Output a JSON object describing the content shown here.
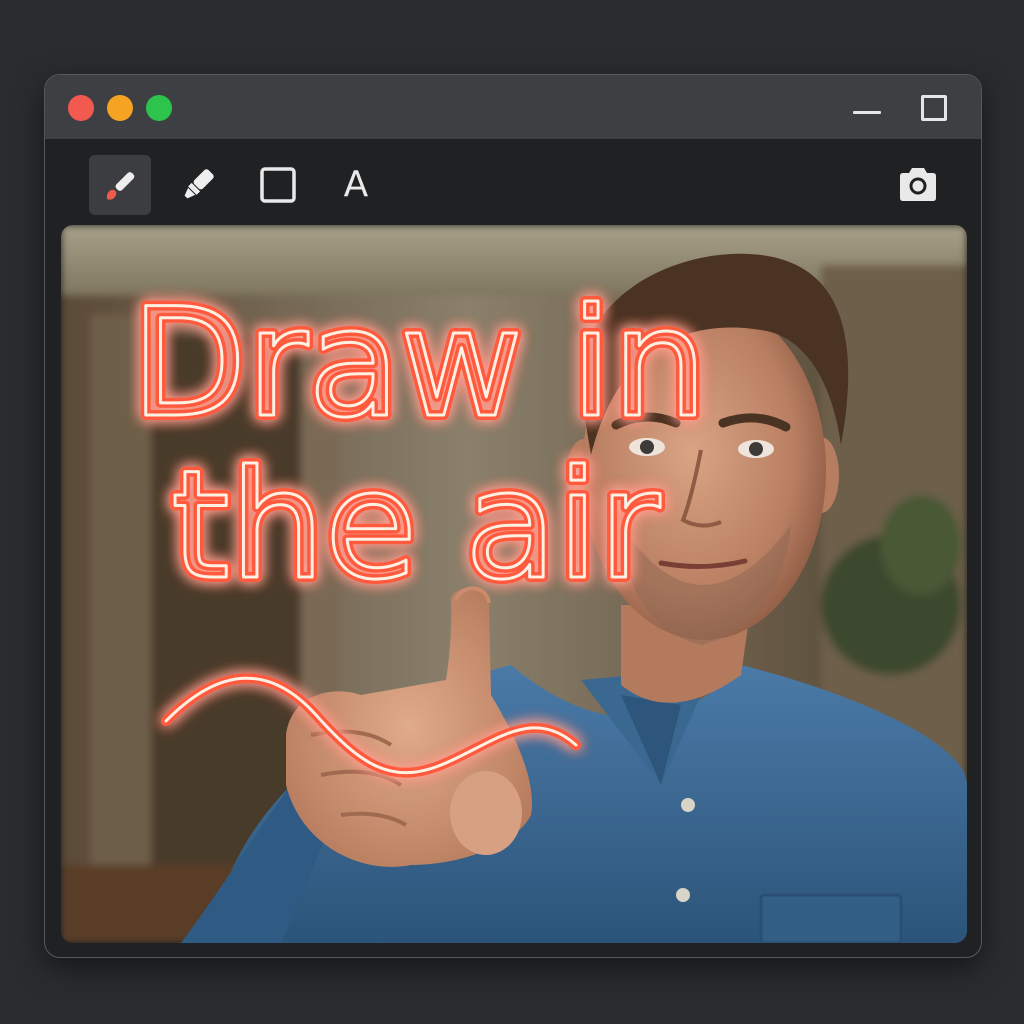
{
  "window": {
    "controls": {
      "close_color": "#f25a4f",
      "minimize_color": "#f4a322",
      "maximize_color": "#2dc44c"
    }
  },
  "toolbar": {
    "tools": [
      {
        "name": "brush",
        "icon": "brush-icon",
        "active": true,
        "accent": "#ee5b4b"
      },
      {
        "name": "highlighter",
        "icon": "highlighter-icon",
        "active": false
      },
      {
        "name": "rectangle",
        "icon": "square-icon",
        "active": false
      },
      {
        "name": "text",
        "icon": "text-icon",
        "label": "A",
        "active": false
      }
    ],
    "camera_icon": "camera-icon"
  },
  "canvas": {
    "drawing_line_1": "Draw in",
    "drawing_line_2": "the air",
    "stroke_color": "#ff5a3c",
    "glow_core_color": "#fff2e6",
    "photo": "person-in-blue-denim-shirt-pointing-finger"
  }
}
